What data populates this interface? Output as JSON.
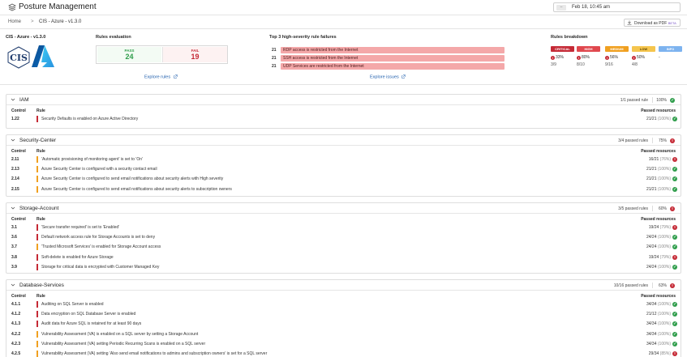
{
  "header": {
    "title": "Posture Management",
    "time_picker": {
      "button": "–",
      "value": "Feb 18, 10:45 am"
    },
    "breadcrumb": {
      "home": "Home",
      "separator": ">",
      "current": "CIS - Azure - v1.3.0"
    },
    "download": {
      "label": "Download as PDF",
      "badge": "BETA"
    }
  },
  "summary": {
    "benchmark": "CIS - Azure - v1.3.0",
    "logo_text": "CIS",
    "rules_evaluation": {
      "title": "Rules evaluation",
      "pass_label": "PASS",
      "pass_value": "24",
      "fail_label": "FAIL",
      "fail_value": "19",
      "explore": "Explore rules"
    },
    "top_failures": {
      "title": "Top 3 high-severity rule failures",
      "items": [
        {
          "count": "21",
          "label": "RDP access is restricted from the Internet"
        },
        {
          "count": "21",
          "label": "SSH access is restricted from the Internet"
        },
        {
          "count": "21",
          "label": "UDP Services are restricted from the Internet"
        }
      ],
      "explore": "Explore issues"
    },
    "breakdown": {
      "title": "Rules breakdown",
      "items": [
        {
          "label": "CRITICAL",
          "pct": "33%",
          "ratio": "3/9",
          "color": "#c52a36",
          "text_color": "#ffffff",
          "warn": true
        },
        {
          "label": "HIGH",
          "pct": "80%",
          "ratio": "8/10",
          "color": "#e0484e",
          "text_color": "#ffffff",
          "warn": true
        },
        {
          "label": "MEDIUM",
          "pct": "56%",
          "ratio": "9/16",
          "color": "#f0a020",
          "text_color": "#ffffff",
          "warn": true
        },
        {
          "label": "LOW",
          "pct": "50%",
          "ratio": "4/8",
          "color": "#f5c54d",
          "text_color": "#5a4200",
          "warn": true
        },
        {
          "label": "INFO",
          "pct": "-",
          "ratio": "",
          "color": "#7db3ef",
          "text_color": "#ffffff",
          "warn": false
        }
      ]
    }
  },
  "columns": {
    "control": "Control",
    "rule": "Rule",
    "passed_resources": "Passed resources"
  },
  "colors": {
    "critical": "#c52a36",
    "medium": "#f0a020",
    "low": "#f5c54d",
    "pass": "#2f9d4b",
    "fail": "#c52a36"
  },
  "sections": [
    {
      "name": "IAM",
      "passed_rules": "1/1 passed rule",
      "pct": "100%",
      "status": "ok",
      "rules": [
        {
          "id": "1.22",
          "name": "Security Defaults is enabled on Azure Active Directory",
          "resources": "21/21",
          "pct": "(100%)",
          "severity": "critical",
          "status": "ok"
        }
      ]
    },
    {
      "name": "Security-Center",
      "passed_rules": "3/4 passed rules",
      "pct": "75%",
      "status": "bad",
      "rules": [
        {
          "id": "2.11",
          "name": "'Automatic provisioning of monitoring agent' is set to 'On'",
          "resources": "16/21",
          "pct": "(76%)",
          "severity": "medium",
          "status": "bad"
        },
        {
          "id": "2.13",
          "name": "Azure Security Center is configured with a security contact email",
          "resources": "21/21",
          "pct": "(100%)",
          "severity": "medium",
          "status": "ok"
        },
        {
          "id": "2.14",
          "name": "Azure Security Center is configured to send email notifications about security alerts with High severity",
          "resources": "21/21",
          "pct": "(100%)",
          "severity": "medium",
          "status": "ok"
        },
        {
          "id": "2.15",
          "name": "Azure Security Center is configured to send email notifications about security alerts to subscription owners",
          "resources": "21/21",
          "pct": "(100%)",
          "severity": "medium",
          "status": "ok"
        }
      ]
    },
    {
      "name": "Storage-Account",
      "passed_rules": "3/5 passed rules",
      "pct": "60%",
      "status": "bad",
      "rules": [
        {
          "id": "3.1",
          "name": "'Secure transfer required' is set to 'Enabled'",
          "resources": "19/24",
          "pct": "(79%)",
          "severity": "critical",
          "status": "bad"
        },
        {
          "id": "3.6",
          "name": "Default network access rule for Storage Accounts is set to deny",
          "resources": "24/24",
          "pct": "(100%)",
          "severity": "critical",
          "status": "ok"
        },
        {
          "id": "3.7",
          "name": "'Trusted Microsoft Services' is enabled for Storage Account access",
          "resources": "24/24",
          "pct": "(100%)",
          "severity": "medium",
          "status": "ok"
        },
        {
          "id": "3.8",
          "name": "Soft-delete is enabled for Azure Storage",
          "resources": "19/24",
          "pct": "(79%)",
          "severity": "critical",
          "status": "bad"
        },
        {
          "id": "3.9",
          "name": "Storage for critical data is encrypted with Customer Managed Key",
          "resources": "24/24",
          "pct": "(100%)",
          "severity": "critical",
          "status": "ok"
        }
      ]
    },
    {
      "name": "Database-Services",
      "passed_rules": "10/16 passed rules",
      "pct": "63%",
      "status": "bad",
      "rules": [
        {
          "id": "4.1.1",
          "name": "Auditing on SQL Server is enabled",
          "resources": "34/34",
          "pct": "(100%)",
          "severity": "critical",
          "status": "ok"
        },
        {
          "id": "4.1.2",
          "name": "Data encryption on SQL Database Server is enabled",
          "resources": "21/12",
          "pct": "(100%)",
          "severity": "critical",
          "status": "ok"
        },
        {
          "id": "4.1.3",
          "name": "Audit data for Azure SQL is retained for at least 90 days",
          "resources": "34/34",
          "pct": "(100%)",
          "severity": "critical",
          "status": "ok"
        },
        {
          "id": "4.2.2",
          "name": "Vulnerability Assessment (VA) is enabled on a SQL server by setting a Storage Account",
          "resources": "34/34",
          "pct": "(100%)",
          "severity": "medium",
          "status": "ok"
        },
        {
          "id": "4.2.3",
          "name": "Vulnerability Assessment (VA) setting Periodic Recurring Scans is enabled on a SQL server",
          "resources": "34/34",
          "pct": "(100%)",
          "severity": "medium",
          "status": "ok"
        },
        {
          "id": "4.2.5",
          "name": "Vulnerability Assessment (VA) setting 'Also send email notifications to admins and subscription owners' is set for a SQL server",
          "resources": "29/34",
          "pct": "(85%)",
          "severity": "medium",
          "status": "bad"
        }
      ]
    }
  ]
}
